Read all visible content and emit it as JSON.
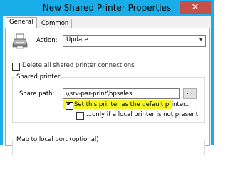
{
  "window": {
    "title": "New Shared Printer Properties",
    "close_glyph": "✕"
  },
  "tabs": [
    {
      "label": "General",
      "active": true
    },
    {
      "label": "Common",
      "active": false
    }
  ],
  "action": {
    "label": "Action:",
    "value": "Update",
    "icon": "printer-icon"
  },
  "delete_all": {
    "label": "Delete all shared printer connections",
    "checked": false
  },
  "shared_printer": {
    "title": "Shared printer",
    "share_path_label": "Share path:",
    "share_path_value": "\\\\srv-par-print\\hpsales",
    "browse_label": "...",
    "set_default": {
      "label": "Set this printer as the default printer...",
      "checked": true
    },
    "only_if_none": {
      "label": "...only if a local printer is not present",
      "checked": false
    }
  },
  "map_local_port": {
    "title": "Map to local port (optional)"
  },
  "colors": {
    "titlebar": "#19aee9",
    "close": "#c74f4a",
    "highlight": "#f6f600"
  }
}
